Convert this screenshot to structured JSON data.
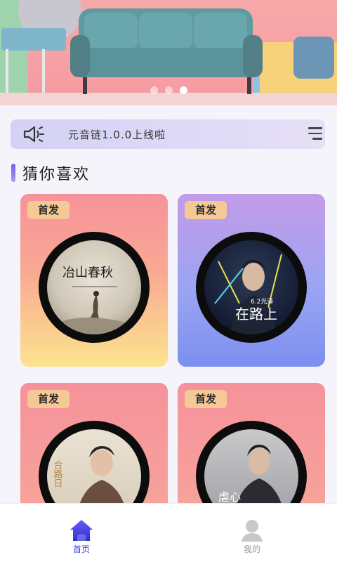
{
  "banner": {
    "slides": 3,
    "active_slide": 3
  },
  "notice": {
    "icon": "speaker-icon",
    "text": "元音链1.0.0上线啦",
    "menu_icon": "menu-icon"
  },
  "section": {
    "title": "猜你喜欢"
  },
  "cards": [
    {
      "badge": "首发",
      "cover_title": "冶山春秋"
    },
    {
      "badge": "首发",
      "cover_title": "在路上",
      "cover_subtitle": "6.2光泽"
    },
    {
      "badge": "首发",
      "cover_title": "合路日"
    },
    {
      "badge": "首发",
      "cover_title": "虐心"
    }
  ],
  "tabbar": {
    "items": [
      {
        "label": "首页",
        "icon": "home-icon",
        "active": true,
        "color": "#3f3fe0"
      },
      {
        "label": "我的",
        "icon": "person-icon",
        "active": false,
        "color": "#999999"
      }
    ]
  }
}
